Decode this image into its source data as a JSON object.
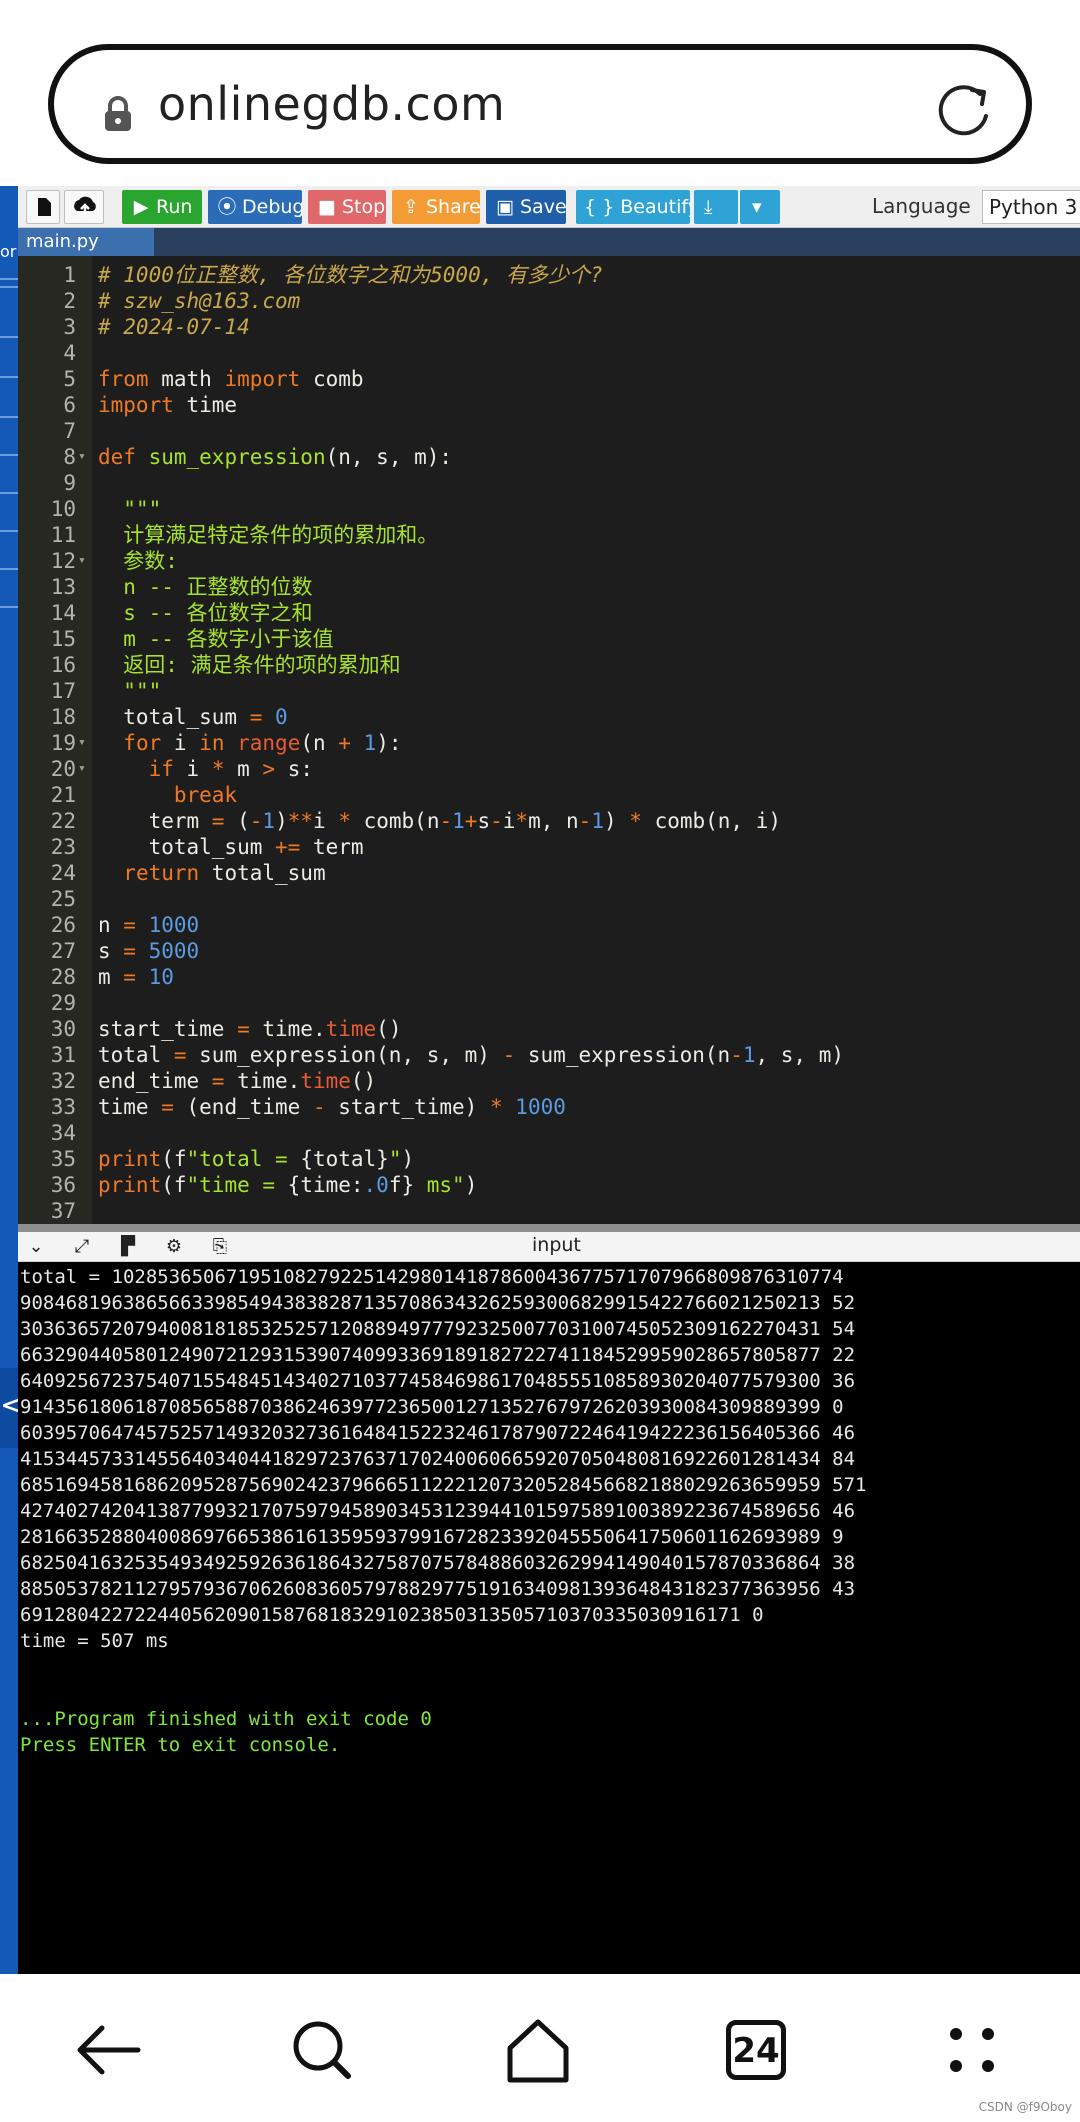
{
  "browser": {
    "url": "onlinegdb.com"
  },
  "sidebar": {
    "partial_text": "or",
    "back_glyph": "<"
  },
  "toolbar": {
    "new_glyph": "",
    "upload_glyph": "",
    "run_label": "Run",
    "debug_label": "Debug",
    "stop_label": "Stop",
    "share_label": "Share",
    "save_label": "Save",
    "beautify_label": "{ } Beautify",
    "language_label": "Language",
    "language_value": "Python 3",
    "colors": {
      "run": "#2aa52f",
      "debug": "#2a6cb8",
      "stop": "#e0686a",
      "share": "#f39c36",
      "save": "#1f5ea8",
      "beautify": "#2fa3d6",
      "download": "#2fa3d6"
    }
  },
  "editor": {
    "tab_label": "main.py",
    "lines": [
      {
        "n": "1",
        "fold": "",
        "tokens": [
          {
            "t": "cm",
            "v": "# 1000位正整数, 各位数字之和为5000, 有多少个?"
          }
        ]
      },
      {
        "n": "2",
        "fold": "",
        "tokens": [
          {
            "t": "cm",
            "v": "# szw_sh@163.com"
          }
        ]
      },
      {
        "n": "3",
        "fold": "",
        "tokens": [
          {
            "t": "cm",
            "v": "# 2024-07-14"
          }
        ]
      },
      {
        "n": "4",
        "fold": "",
        "tokens": []
      },
      {
        "n": "5",
        "fold": "",
        "tokens": [
          {
            "t": "kw",
            "v": "from"
          },
          {
            "t": "",
            "v": " math "
          },
          {
            "t": "kw",
            "v": "import"
          },
          {
            "t": "",
            "v": " comb"
          }
        ]
      },
      {
        "n": "6",
        "fold": "",
        "tokens": [
          {
            "t": "kw",
            "v": "import"
          },
          {
            "t": "",
            "v": " time"
          }
        ]
      },
      {
        "n": "7",
        "fold": "",
        "tokens": []
      },
      {
        "n": "8",
        "fold": "▾",
        "tokens": [
          {
            "t": "kw",
            "v": "def"
          },
          {
            "t": "",
            "v": " "
          },
          {
            "t": "fn",
            "v": "sum_expression"
          },
          {
            "t": "",
            "v": "(n, s, m):"
          }
        ]
      },
      {
        "n": "9",
        "fold": "",
        "tokens": []
      },
      {
        "n": "10",
        "fold": "",
        "tokens": [
          {
            "t": "",
            "v": "  "
          },
          {
            "t": "doc",
            "v": "\"\"\""
          }
        ]
      },
      {
        "n": "11",
        "fold": "",
        "tokens": [
          {
            "t": "",
            "v": "  "
          },
          {
            "t": "doc",
            "v": "计算满足特定条件的项的累加和。"
          }
        ]
      },
      {
        "n": "12",
        "fold": "▾",
        "tokens": [
          {
            "t": "",
            "v": "  "
          },
          {
            "t": "doc",
            "v": "参数:"
          }
        ]
      },
      {
        "n": "13",
        "fold": "",
        "tokens": [
          {
            "t": "",
            "v": "  "
          },
          {
            "t": "doc",
            "v": "n -- 正整数的位数"
          }
        ]
      },
      {
        "n": "14",
        "fold": "",
        "tokens": [
          {
            "t": "",
            "v": "  "
          },
          {
            "t": "doc",
            "v": "s -- 各位数字之和"
          }
        ]
      },
      {
        "n": "15",
        "fold": "",
        "tokens": [
          {
            "t": "",
            "v": "  "
          },
          {
            "t": "doc",
            "v": "m -- 各数字小于该值"
          }
        ]
      },
      {
        "n": "16",
        "fold": "",
        "tokens": [
          {
            "t": "",
            "v": "  "
          },
          {
            "t": "doc",
            "v": "返回: 满足条件的项的累加和"
          }
        ]
      },
      {
        "n": "17",
        "fold": "",
        "tokens": [
          {
            "t": "",
            "v": "  "
          },
          {
            "t": "doc",
            "v": "\"\"\""
          }
        ]
      },
      {
        "n": "18",
        "fold": "",
        "tokens": [
          {
            "t": "",
            "v": "  total_sum "
          },
          {
            "t": "op",
            "v": "="
          },
          {
            "t": "",
            "v": " "
          },
          {
            "t": "num",
            "v": "0"
          }
        ]
      },
      {
        "n": "19",
        "fold": "▾",
        "tokens": [
          {
            "t": "",
            "v": "  "
          },
          {
            "t": "kw",
            "v": "for"
          },
          {
            "t": "",
            "v": " i "
          },
          {
            "t": "kw",
            "v": "in"
          },
          {
            "t": "",
            "v": " "
          },
          {
            "t": "bi",
            "v": "range"
          },
          {
            "t": "",
            "v": "(n "
          },
          {
            "t": "op",
            "v": "+"
          },
          {
            "t": "",
            "v": " "
          },
          {
            "t": "num",
            "v": "1"
          },
          {
            "t": "",
            "v": "):"
          }
        ]
      },
      {
        "n": "20",
        "fold": "▾",
        "tokens": [
          {
            "t": "",
            "v": "    "
          },
          {
            "t": "kw",
            "v": "if"
          },
          {
            "t": "",
            "v": " i "
          },
          {
            "t": "op",
            "v": "*"
          },
          {
            "t": "",
            "v": " m "
          },
          {
            "t": "op",
            "v": ">"
          },
          {
            "t": "",
            "v": " s:"
          }
        ]
      },
      {
        "n": "21",
        "fold": "",
        "tokens": [
          {
            "t": "",
            "v": "      "
          },
          {
            "t": "kw",
            "v": "break"
          }
        ]
      },
      {
        "n": "22",
        "fold": "",
        "tokens": [
          {
            "t": "",
            "v": "    term "
          },
          {
            "t": "op",
            "v": "="
          },
          {
            "t": "",
            "v": " ("
          },
          {
            "t": "op",
            "v": "-"
          },
          {
            "t": "num",
            "v": "1"
          },
          {
            "t": "",
            "v": ")"
          },
          {
            "t": "op",
            "v": "**"
          },
          {
            "t": "",
            "v": "i "
          },
          {
            "t": "op",
            "v": "*"
          },
          {
            "t": "",
            "v": " comb(n"
          },
          {
            "t": "op",
            "v": "-"
          },
          {
            "t": "num",
            "v": "1"
          },
          {
            "t": "op",
            "v": "+"
          },
          {
            "t": "",
            "v": "s"
          },
          {
            "t": "op",
            "v": "-"
          },
          {
            "t": "",
            "v": "i"
          },
          {
            "t": "op",
            "v": "*"
          },
          {
            "t": "",
            "v": "m, n"
          },
          {
            "t": "op",
            "v": "-"
          },
          {
            "t": "num",
            "v": "1"
          },
          {
            "t": "",
            "v": ") "
          },
          {
            "t": "op",
            "v": "*"
          },
          {
            "t": "",
            "v": " comb(n, i)"
          }
        ]
      },
      {
        "n": "23",
        "fold": "",
        "tokens": [
          {
            "t": "",
            "v": "    total_sum "
          },
          {
            "t": "op",
            "v": "+="
          },
          {
            "t": "",
            "v": " term"
          }
        ]
      },
      {
        "n": "24",
        "fold": "",
        "tokens": [
          {
            "t": "",
            "v": "  "
          },
          {
            "t": "kw",
            "v": "return"
          },
          {
            "t": "",
            "v": " total_sum"
          }
        ]
      },
      {
        "n": "25",
        "fold": "",
        "tokens": []
      },
      {
        "n": "26",
        "fold": "",
        "tokens": [
          {
            "t": "",
            "v": "n "
          },
          {
            "t": "op",
            "v": "="
          },
          {
            "t": "",
            "v": " "
          },
          {
            "t": "num",
            "v": "1000"
          }
        ]
      },
      {
        "n": "27",
        "fold": "",
        "tokens": [
          {
            "t": "",
            "v": "s "
          },
          {
            "t": "op",
            "v": "="
          },
          {
            "t": "",
            "v": " "
          },
          {
            "t": "num",
            "v": "5000"
          }
        ]
      },
      {
        "n": "28",
        "fold": "",
        "tokens": [
          {
            "t": "",
            "v": "m "
          },
          {
            "t": "op",
            "v": "="
          },
          {
            "t": "",
            "v": " "
          },
          {
            "t": "num",
            "v": "10"
          }
        ]
      },
      {
        "n": "29",
        "fold": "",
        "tokens": []
      },
      {
        "n": "30",
        "fold": "",
        "tokens": [
          {
            "t": "",
            "v": "start_time "
          },
          {
            "t": "op",
            "v": "="
          },
          {
            "t": "",
            "v": " time."
          },
          {
            "t": "bi",
            "v": "time"
          },
          {
            "t": "",
            "v": "()"
          }
        ]
      },
      {
        "n": "31",
        "fold": "",
        "tokens": [
          {
            "t": "",
            "v": "total "
          },
          {
            "t": "op",
            "v": "="
          },
          {
            "t": "",
            "v": " sum_expression(n, s, m) "
          },
          {
            "t": "op",
            "v": "-"
          },
          {
            "t": "",
            "v": " sum_expression(n"
          },
          {
            "t": "op",
            "v": "-"
          },
          {
            "t": "num",
            "v": "1"
          },
          {
            "t": "",
            "v": ", s, m)"
          }
        ]
      },
      {
        "n": "32",
        "fold": "",
        "tokens": [
          {
            "t": "",
            "v": "end_time "
          },
          {
            "t": "op",
            "v": "="
          },
          {
            "t": "",
            "v": " time."
          },
          {
            "t": "bi",
            "v": "time"
          },
          {
            "t": "",
            "v": "()"
          }
        ]
      },
      {
        "n": "33",
        "fold": "",
        "tokens": [
          {
            "t": "",
            "v": "time "
          },
          {
            "t": "op",
            "v": "="
          },
          {
            "t": "",
            "v": " (end_time "
          },
          {
            "t": "op",
            "v": "-"
          },
          {
            "t": "",
            "v": " start_time) "
          },
          {
            "t": "op",
            "v": "*"
          },
          {
            "t": "",
            "v": " "
          },
          {
            "t": "num",
            "v": "1000"
          }
        ]
      },
      {
        "n": "34",
        "fold": "",
        "tokens": []
      },
      {
        "n": "35",
        "fold": "",
        "tokens": [
          {
            "t": "kw",
            "v": "print"
          },
          {
            "t": "",
            "v": "(f"
          },
          {
            "t": "str",
            "v": "\"total = "
          },
          {
            "t": "",
            "v": "{total}"
          },
          {
            "t": "str",
            "v": "\""
          },
          {
            "t": "",
            "v": ")"
          }
        ]
      },
      {
        "n": "36",
        "fold": "",
        "tokens": [
          {
            "t": "kw",
            "v": "print"
          },
          {
            "t": "",
            "v": "(f"
          },
          {
            "t": "str",
            "v": "\"time = "
          },
          {
            "t": "",
            "v": "{time:"
          },
          {
            "t": "num",
            "v": ".0"
          },
          {
            "t": "",
            "v": "f}"
          },
          {
            "t": "str",
            "v": " ms\""
          },
          {
            "t": "",
            "v": ")"
          }
        ]
      },
      {
        "n": "37",
        "fold": "",
        "tokens": []
      }
    ]
  },
  "console": {
    "input_label": "input",
    "output_lines": [
      "total = 1028536506719510827922514298014187860043677571707966809876310774",
      "9084681963865663398549438382871357086343262593006829915422766021250213 52",
      "3036365720794008181853252571208894977792325007703100745052309162270431 54",
      "6632904405801249072129315390740993369189182722741184529959028657805877 22",
      "6409256723754071554845143402710377458469861704855510858930204077579300 36",
      "9143561806187085658870386246397723650012713527679726203930084309889399 0",
      "6039570647457525714932032736164841522324617879072246419422236156405366 46",
      "4153445733145564034044182972376371702400606659207050480816922601281434 84",
      "6851694581686209528756902423796665112221207320528456682188029263659959 571",
      "4274027420413877993217075979458903453123944101597589100389223674589656 46",
      "2816635288040086976653861613595937991672823392045550641750601162693989 9",
      "6825041632535493492592636186432758707578488603262994149040157870336864 38",
      "8850537821127957936706260836057978829775191634098139364843182377363956 43",
      "691280422722440562090158768183291023850313505710370335030916171 0",
      "time = 507 ms",
      "",
      "",
      "...Program finished with exit code 0",
      "Press ENTER to exit console."
    ]
  },
  "nav": {
    "tabs_count": "24"
  },
  "watermark": "CSDN @f9Oboy"
}
